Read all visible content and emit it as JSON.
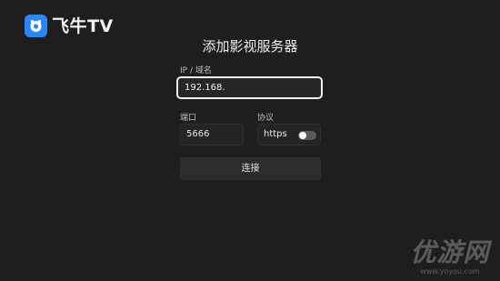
{
  "app": {
    "name": "飞牛TV",
    "logo_icon": "fnos-cow-logo-icon",
    "accent": "#2a86ff"
  },
  "dialog": {
    "title": "添加影视服务器",
    "host": {
      "label": "IP / 域名",
      "value": "192.168."
    },
    "port": {
      "label": "端口",
      "value": "5666"
    },
    "protocol": {
      "label": "协议",
      "value": "https",
      "toggle_on": false
    },
    "connect_label": "连接"
  },
  "watermark": {
    "text": "优游网",
    "url": "www.yoyou.com"
  }
}
